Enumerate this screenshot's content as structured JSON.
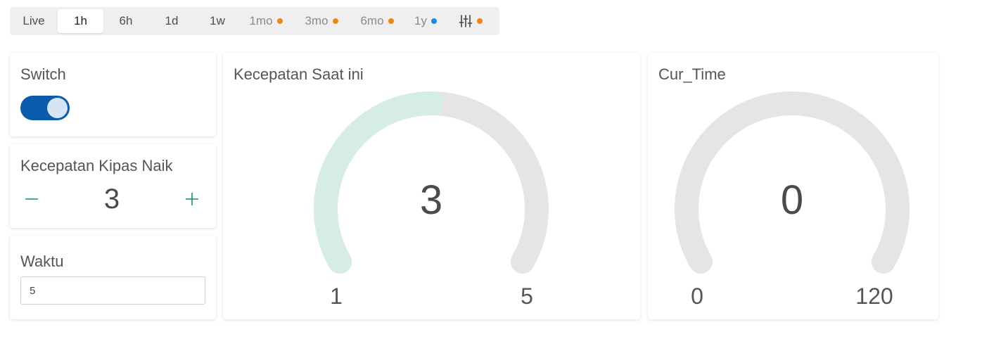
{
  "range_bar": {
    "items": [
      {
        "label": "Live",
        "dot": null,
        "active": false,
        "muted": false
      },
      {
        "label": "1h",
        "dot": null,
        "active": true,
        "muted": false
      },
      {
        "label": "6h",
        "dot": null,
        "active": false,
        "muted": false
      },
      {
        "label": "1d",
        "dot": null,
        "active": false,
        "muted": false
      },
      {
        "label": "1w",
        "dot": null,
        "active": false,
        "muted": false
      },
      {
        "label": "1mo",
        "dot": "#f0850f",
        "active": false,
        "muted": true
      },
      {
        "label": "3mo",
        "dot": "#f0850f",
        "active": false,
        "muted": true
      },
      {
        "label": "6mo",
        "dot": "#f0850f",
        "active": false,
        "muted": true
      },
      {
        "label": "1y",
        "dot": "#1e88e5",
        "active": false,
        "muted": true
      }
    ],
    "custom_icon": "sliders-icon",
    "custom_dot": "#f0850f"
  },
  "switch_widget": {
    "title": "Switch",
    "state": "on",
    "track_color": "#0b5cad"
  },
  "stepper_widget": {
    "title": "Kecepatan Kipas Naik",
    "value": "3",
    "minus_icon": "minus-icon",
    "plus_icon": "plus-icon",
    "accent": "#1a8f5a"
  },
  "input_widget": {
    "title": "Waktu",
    "value": "5"
  },
  "gauge_speed": {
    "title": "Kecepatan Saat ini",
    "value": "3",
    "min": "1",
    "max": "5",
    "fill_color": "#d6ede4",
    "track_color": "#e5e5e5"
  },
  "gauge_time": {
    "title": "Cur_Time",
    "value": "0",
    "min": "0",
    "max": "120",
    "fill_color": "#d6ede4",
    "track_color": "#e5e5e5"
  }
}
